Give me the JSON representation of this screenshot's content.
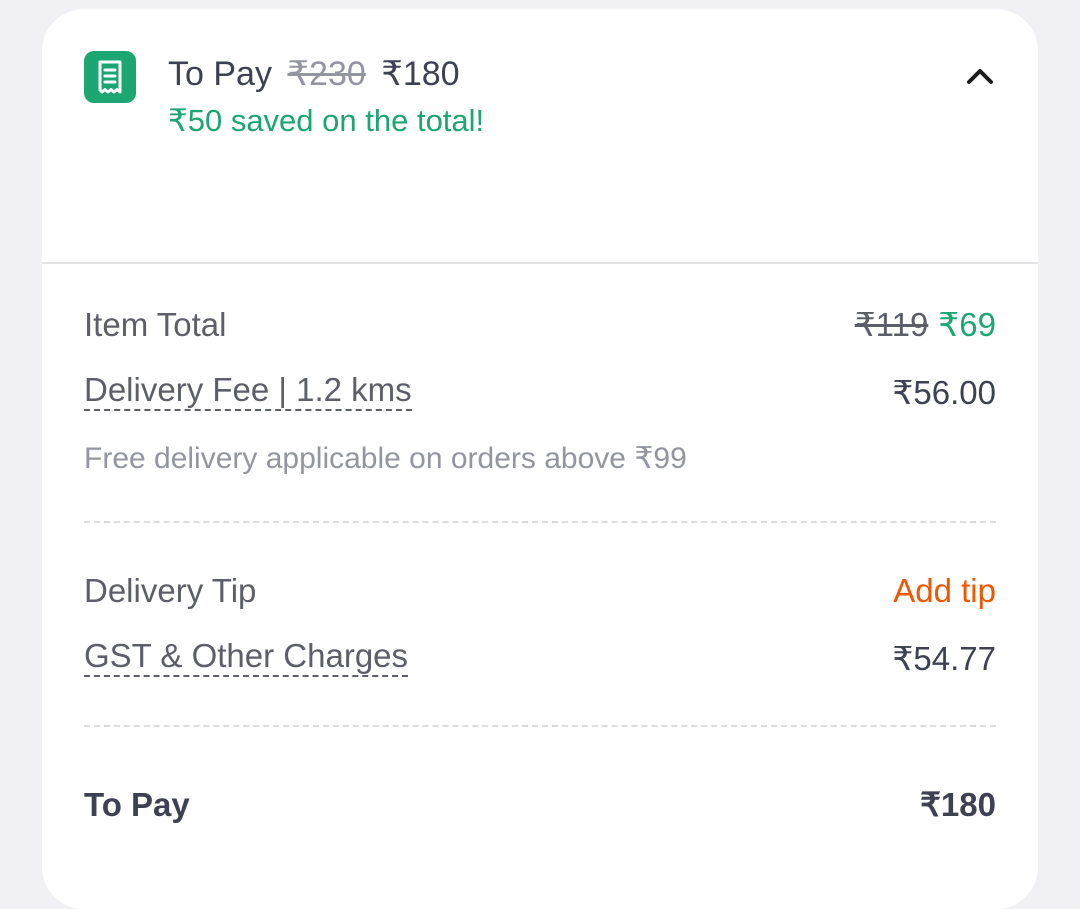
{
  "header": {
    "icon": "receipt-icon",
    "title": "To Pay",
    "original_total": "₹230",
    "total": "₹180",
    "savings_text": "₹50 saved on the total!",
    "toggle_icon": "chevron-up-icon"
  },
  "bill": {
    "item_total": {
      "label": "Item Total",
      "original": "₹119",
      "discounted": "₹69"
    },
    "delivery_fee": {
      "label": "Delivery Fee | 1.2 kms",
      "value": "₹56.00",
      "note": "Free delivery applicable on orders above ₹99"
    },
    "delivery_tip": {
      "label": "Delivery Tip",
      "action": "Add tip"
    },
    "gst": {
      "label": "GST & Other Charges",
      "value": "₹54.77"
    },
    "to_pay": {
      "label": "To Pay",
      "value": "₹180"
    }
  },
  "colors": {
    "accent_green": "#1ba672",
    "accent_orange": "#f15700",
    "text_dark": "#3d4152",
    "text_muted": "#93959f"
  }
}
